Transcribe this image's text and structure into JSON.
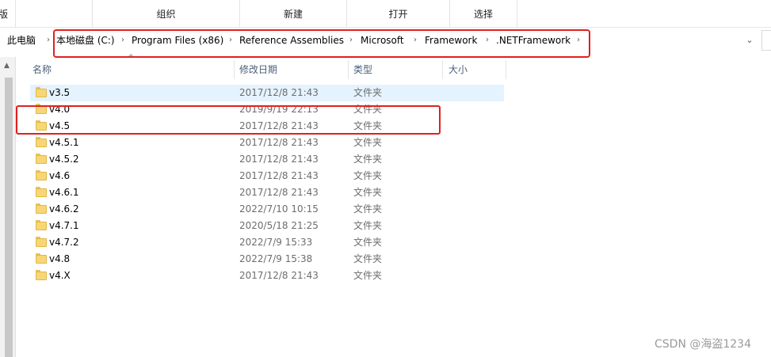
{
  "ribbon": {
    "groups": [
      "版",
      "",
      "组织",
      "新建",
      "打开",
      "选择"
    ]
  },
  "address_bar": {
    "crumbs": [
      "此电脑",
      "本地磁盘 (C:)",
      "Program Files (x86)",
      "Reference Assemblies",
      "Microsoft",
      "Framework",
      ".NETFramework"
    ],
    "dropdown_icon": "chevron-down-icon"
  },
  "columns": {
    "name": "名称",
    "date": "修改日期",
    "type": "类型",
    "size": "大小"
  },
  "rows": [
    {
      "name": "v3.5",
      "date": "2017/12/8 21:43",
      "type": "文件夹",
      "selected": true
    },
    {
      "name": "v4.0",
      "date": "2019/9/19 22:13",
      "type": "文件夹"
    },
    {
      "name": "v4.5",
      "date": "2017/12/8 21:43",
      "type": "文件夹"
    },
    {
      "name": "v4.5.1",
      "date": "2017/12/8 21:43",
      "type": "文件夹"
    },
    {
      "name": "v4.5.2",
      "date": "2017/12/8 21:43",
      "type": "文件夹"
    },
    {
      "name": "v4.6",
      "date": "2017/12/8 21:43",
      "type": "文件夹"
    },
    {
      "name": "v4.6.1",
      "date": "2017/12/8 21:43",
      "type": "文件夹"
    },
    {
      "name": "v4.6.2",
      "date": "2022/7/10 10:15",
      "type": "文件夹"
    },
    {
      "name": "v4.7.1",
      "date": "2020/5/18 21:25",
      "type": "文件夹"
    },
    {
      "name": "v4.7.2",
      "date": "2022/7/9 15:33",
      "type": "文件夹"
    },
    {
      "name": "v4.8",
      "date": "2022/7/9 15:38",
      "type": "文件夹"
    },
    {
      "name": "v4.X",
      "date": "2017/12/8 21:43",
      "type": "文件夹"
    }
  ],
  "watermark": "CSDN @海盗1234",
  "colors": {
    "highlight_box": "#e02020",
    "selected_row": "#e5f3ff",
    "folder": "#f7d675"
  }
}
